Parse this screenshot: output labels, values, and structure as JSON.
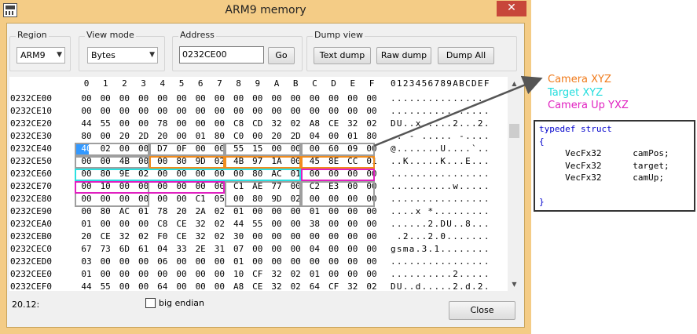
{
  "window": {
    "title": "ARM9 memory",
    "close_symbol": "✕"
  },
  "region": {
    "label": "Region",
    "value": "ARM9"
  },
  "view_mode": {
    "label": "View mode",
    "value": "Bytes"
  },
  "address": {
    "label": "Address",
    "value": "0232CE00",
    "go_label": "Go"
  },
  "dump_view": {
    "label": "Dump view",
    "text_dump": "Text dump",
    "raw_dump": "Raw dump",
    "dump_all": "Dump All"
  },
  "hex": {
    "columns": [
      "0",
      "1",
      "2",
      "3",
      "4",
      "5",
      "6",
      "7",
      "8",
      "9",
      "A",
      "B",
      "C",
      "D",
      "E",
      "F"
    ],
    "ascii_header": "0123456789ABCDEF",
    "rows": [
      {
        "addr": "0232CE00",
        "bytes": [
          "00",
          "00",
          "00",
          "00",
          "00",
          "00",
          "00",
          "00",
          "00",
          "00",
          "00",
          "00",
          "00",
          "00",
          "00",
          "00"
        ],
        "ascii": "................"
      },
      {
        "addr": "0232CE10",
        "bytes": [
          "00",
          "00",
          "00",
          "00",
          "00",
          "00",
          "00",
          "00",
          "00",
          "00",
          "00",
          "00",
          "00",
          "00",
          "00",
          "00"
        ],
        "ascii": "................"
      },
      {
        "addr": "0232CE20",
        "bytes": [
          "44",
          "55",
          "00",
          "00",
          "78",
          "00",
          "00",
          "00",
          "C8",
          "CD",
          "32",
          "02",
          "A8",
          "CE",
          "32",
          "02"
        ],
        "ascii": "DU..x.....2...2."
      },
      {
        "addr": "0232CE30",
        "bytes": [
          "80",
          "00",
          "20",
          "2D",
          "20",
          "00",
          "01",
          "80",
          "C0",
          "00",
          "20",
          "2D",
          "04",
          "00",
          "01",
          "80"
        ],
        "ascii": ".. - ..... -...."
      },
      {
        "addr": "0232CE40",
        "bytes": [
          "40",
          "02",
          "00",
          "00",
          "D7",
          "0F",
          "00",
          "00",
          "55",
          "15",
          "00",
          "00",
          "00",
          "60",
          "09",
          "00"
        ],
        "ascii": "@.......U....`.."
      },
      {
        "addr": "0232CE50",
        "bytes": [
          "00",
          "00",
          "4B",
          "00",
          "00",
          "80",
          "9D",
          "02",
          "4B",
          "97",
          "1A",
          "00",
          "45",
          "8E",
          "CC",
          "01"
        ],
        "ascii": "..K.....K...E..."
      },
      {
        "addr": "0232CE60",
        "bytes": [
          "00",
          "80",
          "9E",
          "02",
          "00",
          "00",
          "00",
          "00",
          "00",
          "80",
          "AC",
          "01",
          "00",
          "00",
          "00",
          "00"
        ],
        "ascii": "................"
      },
      {
        "addr": "0232CE70",
        "bytes": [
          "00",
          "10",
          "00",
          "00",
          "00",
          "00",
          "00",
          "00",
          "C1",
          "AE",
          "77",
          "00",
          "C2",
          "E3",
          "00",
          "00"
        ],
        "ascii": "..........w....."
      },
      {
        "addr": "0232CE80",
        "bytes": [
          "00",
          "00",
          "00",
          "00",
          "00",
          "00",
          "C1",
          "05",
          "00",
          "80",
          "9D",
          "02",
          "00",
          "00",
          "00",
          "00"
        ],
        "ascii": "................"
      },
      {
        "addr": "0232CE90",
        "bytes": [
          "00",
          "80",
          "AC",
          "01",
          "78",
          "20",
          "2A",
          "02",
          "01",
          "00",
          "00",
          "00",
          "01",
          "00",
          "00",
          "00"
        ],
        "ascii": "....x *........."
      },
      {
        "addr": "0232CEA0",
        "bytes": [
          "01",
          "00",
          "00",
          "00",
          "C8",
          "CE",
          "32",
          "02",
          "44",
          "55",
          "00",
          "00",
          "38",
          "00",
          "00",
          "00"
        ],
        "ascii": "......2.DU..8..."
      },
      {
        "addr": "0232CEB0",
        "bytes": [
          "20",
          "CE",
          "32",
          "02",
          "F0",
          "CE",
          "32",
          "02",
          "30",
          "00",
          "00",
          "00",
          "00",
          "00",
          "00",
          "00"
        ],
        "ascii": " .2...2.0......."
      },
      {
        "addr": "0232CEC0",
        "bytes": [
          "67",
          "73",
          "6D",
          "61",
          "04",
          "33",
          "2E",
          "31",
          "07",
          "00",
          "00",
          "00",
          "04",
          "00",
          "00",
          "00"
        ],
        "ascii": "gsma.3.1........"
      },
      {
        "addr": "0232CED0",
        "bytes": [
          "03",
          "00",
          "00",
          "00",
          "06",
          "00",
          "00",
          "00",
          "01",
          "00",
          "00",
          "00",
          "00",
          "00",
          "00",
          "00"
        ],
        "ascii": "................"
      },
      {
        "addr": "0232CEE0",
        "bytes": [
          "01",
          "00",
          "00",
          "00",
          "00",
          "00",
          "00",
          "00",
          "10",
          "CF",
          "32",
          "02",
          "01",
          "00",
          "00",
          "00"
        ],
        "ascii": "..........2....."
      },
      {
        "addr": "0232CEF0",
        "bytes": [
          "44",
          "55",
          "00",
          "00",
          "64",
          "00",
          "00",
          "00",
          "A8",
          "CE",
          "32",
          "02",
          "64",
          "CF",
          "32",
          "02"
        ],
        "ascii": "DU..d.....2.d.2."
      }
    ]
  },
  "status": {
    "text": "20.12:"
  },
  "big_endian": {
    "label": "big endian",
    "checked": false
  },
  "close_button": {
    "label": "Close"
  },
  "annotations": {
    "camera_xyz": "Camera XYZ",
    "target_xyz": "Target XYZ",
    "camera_up": "Camera Up YXZ",
    "colors": {
      "camera": "#f07a1a",
      "target": "#22dddd",
      "up": "#e020c0"
    },
    "code_lines": [
      [
        {
          "t": "typedef struct",
          "kw": true
        }
      ],
      [
        {
          "t": "{",
          "kw": true
        }
      ],
      [
        {
          "t": "     VecFx32      camPos;",
          "kw": false
        }
      ],
      [
        {
          "t": "     VecFx32      target;",
          "kw": false
        }
      ],
      [
        {
          "t": "     VecFx32      camUp;",
          "kw": false
        }
      ],
      [
        {
          "t": "",
          "kw": false
        }
      ],
      [
        {
          "t": "}",
          "kw": true
        }
      ]
    ]
  }
}
